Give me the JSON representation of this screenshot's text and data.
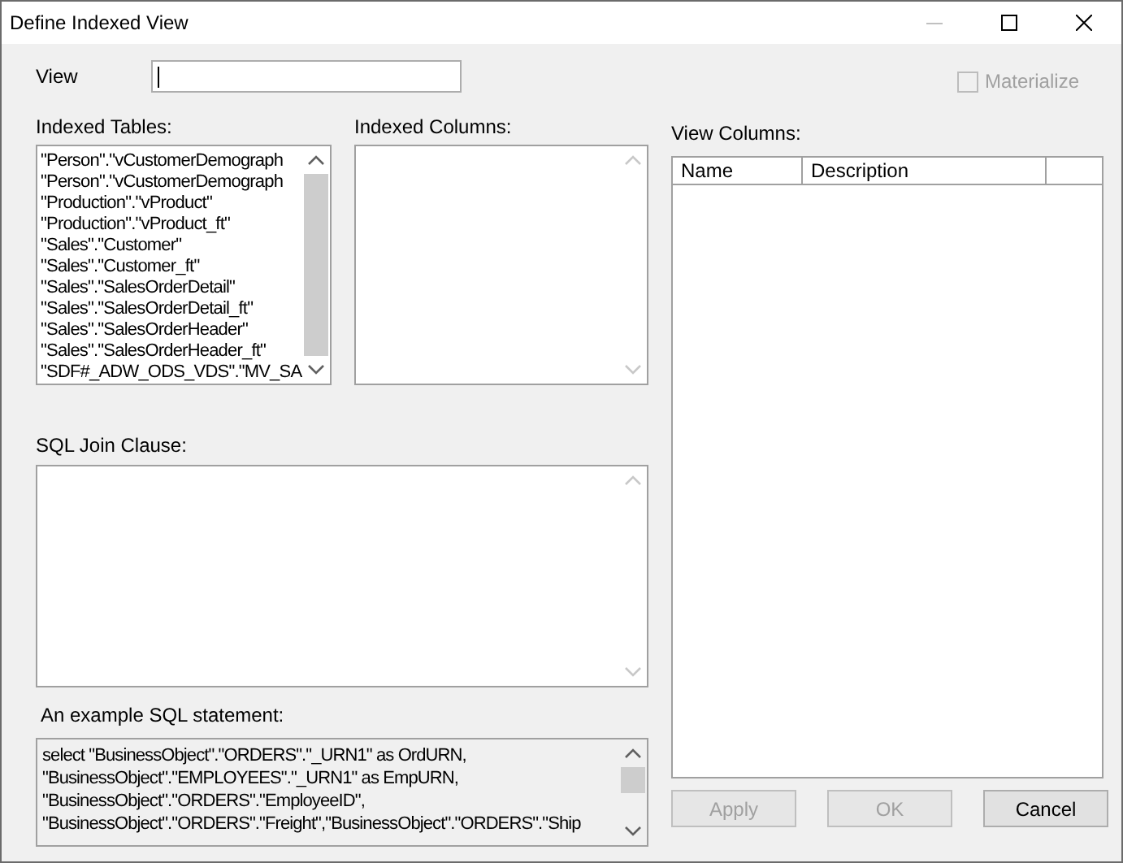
{
  "window": {
    "title": "Define Indexed View"
  },
  "view": {
    "label": "View"
  },
  "materialize": {
    "label": "Materialize",
    "checked": false,
    "disabled": true
  },
  "indexed_tables": {
    "label": "Indexed Tables:",
    "items": [
      {
        "text": "\"Person\".\"vCustomerDemograph",
        "selected": false
      },
      {
        "text": "\"Person\".\"vCustomerDemograph",
        "selected": false
      },
      {
        "text": "\"Production\".\"vProduct\"",
        "selected": false
      },
      {
        "text": "\"Production\".\"vProduct_ft\"",
        "selected": false
      },
      {
        "text": "\"Sales\".\"Customer\"",
        "selected": false
      },
      {
        "text": "\"Sales\".\"Customer_ft\"",
        "selected": false
      },
      {
        "text": "\"Sales\".\"SalesOrderDetail\"",
        "selected": false
      },
      {
        "text": "\"Sales\".\"SalesOrderDetail_ft\"",
        "selected": false
      },
      {
        "text": "\"Sales\".\"SalesOrderHeader\"",
        "selected": false
      },
      {
        "text": "\"Sales\".\"SalesOrderHeader_ft\"",
        "selected": false
      },
      {
        "text": "\"SDF#_ADW_ODS_VDS\".\"MV_SA",
        "selected": false
      }
    ]
  },
  "indexed_columns": {
    "label": "Indexed Columns:"
  },
  "view_columns": {
    "label": "View Columns:",
    "columns": [
      "Name",
      "Description"
    ]
  },
  "sql_join_clause": {
    "label": "SQL Join Clause:"
  },
  "example_sql": {
    "label": "An example SQL statement:",
    "lines": [
      "select \"BusinessObject\".\"ORDERS\".\"_URN1\" as OrdURN,",
      "\"BusinessObject\".\"EMPLOYEES\".\"_URN1\" as EmpURN,",
      "\"BusinessObject\".\"ORDERS\".\"EmployeeID\",",
      "\"BusinessObject\".\"ORDERS\".\"Freight\",\"BusinessObject\".\"ORDERS\".\"Ship"
    ]
  },
  "buttons": [
    {
      "label": "Apply",
      "disabled": true
    },
    {
      "label": "OK",
      "disabled": true
    },
    {
      "label": "Cancel",
      "disabled": false
    }
  ]
}
